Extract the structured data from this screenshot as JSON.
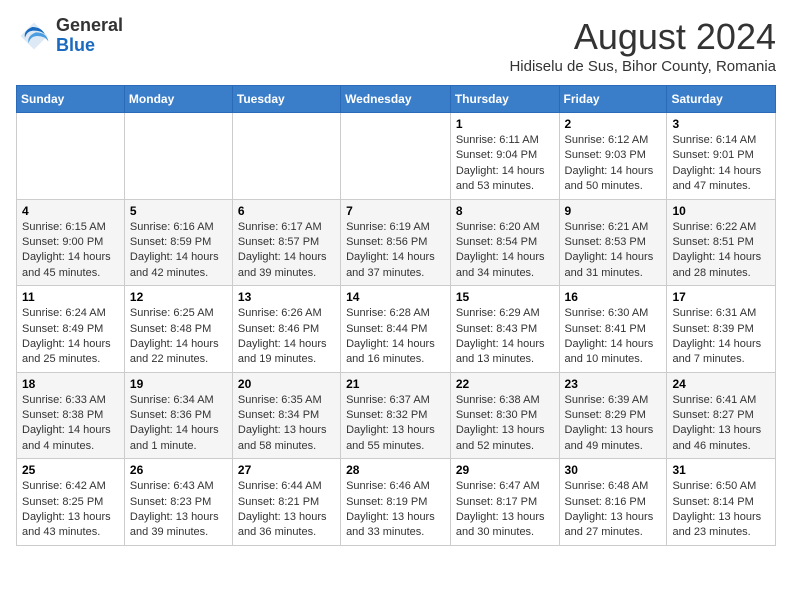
{
  "header": {
    "logo_general": "General",
    "logo_blue": "Blue",
    "month_year": "August 2024",
    "location": "Hidiselu de Sus, Bihor County, Romania"
  },
  "days_of_week": [
    "Sunday",
    "Monday",
    "Tuesday",
    "Wednesday",
    "Thursday",
    "Friday",
    "Saturday"
  ],
  "weeks": [
    [
      {
        "day": "",
        "info": ""
      },
      {
        "day": "",
        "info": ""
      },
      {
        "day": "",
        "info": ""
      },
      {
        "day": "",
        "info": ""
      },
      {
        "day": "1",
        "info": "Sunrise: 6:11 AM\nSunset: 9:04 PM\nDaylight: 14 hours and 53 minutes."
      },
      {
        "day": "2",
        "info": "Sunrise: 6:12 AM\nSunset: 9:03 PM\nDaylight: 14 hours and 50 minutes."
      },
      {
        "day": "3",
        "info": "Sunrise: 6:14 AM\nSunset: 9:01 PM\nDaylight: 14 hours and 47 minutes."
      }
    ],
    [
      {
        "day": "4",
        "info": "Sunrise: 6:15 AM\nSunset: 9:00 PM\nDaylight: 14 hours and 45 minutes."
      },
      {
        "day": "5",
        "info": "Sunrise: 6:16 AM\nSunset: 8:59 PM\nDaylight: 14 hours and 42 minutes."
      },
      {
        "day": "6",
        "info": "Sunrise: 6:17 AM\nSunset: 8:57 PM\nDaylight: 14 hours and 39 minutes."
      },
      {
        "day": "7",
        "info": "Sunrise: 6:19 AM\nSunset: 8:56 PM\nDaylight: 14 hours and 37 minutes."
      },
      {
        "day": "8",
        "info": "Sunrise: 6:20 AM\nSunset: 8:54 PM\nDaylight: 14 hours and 34 minutes."
      },
      {
        "day": "9",
        "info": "Sunrise: 6:21 AM\nSunset: 8:53 PM\nDaylight: 14 hours and 31 minutes."
      },
      {
        "day": "10",
        "info": "Sunrise: 6:22 AM\nSunset: 8:51 PM\nDaylight: 14 hours and 28 minutes."
      }
    ],
    [
      {
        "day": "11",
        "info": "Sunrise: 6:24 AM\nSunset: 8:49 PM\nDaylight: 14 hours and 25 minutes."
      },
      {
        "day": "12",
        "info": "Sunrise: 6:25 AM\nSunset: 8:48 PM\nDaylight: 14 hours and 22 minutes."
      },
      {
        "day": "13",
        "info": "Sunrise: 6:26 AM\nSunset: 8:46 PM\nDaylight: 14 hours and 19 minutes."
      },
      {
        "day": "14",
        "info": "Sunrise: 6:28 AM\nSunset: 8:44 PM\nDaylight: 14 hours and 16 minutes."
      },
      {
        "day": "15",
        "info": "Sunrise: 6:29 AM\nSunset: 8:43 PM\nDaylight: 14 hours and 13 minutes."
      },
      {
        "day": "16",
        "info": "Sunrise: 6:30 AM\nSunset: 8:41 PM\nDaylight: 14 hours and 10 minutes."
      },
      {
        "day": "17",
        "info": "Sunrise: 6:31 AM\nSunset: 8:39 PM\nDaylight: 14 hours and 7 minutes."
      }
    ],
    [
      {
        "day": "18",
        "info": "Sunrise: 6:33 AM\nSunset: 8:38 PM\nDaylight: 14 hours and 4 minutes."
      },
      {
        "day": "19",
        "info": "Sunrise: 6:34 AM\nSunset: 8:36 PM\nDaylight: 14 hours and 1 minute."
      },
      {
        "day": "20",
        "info": "Sunrise: 6:35 AM\nSunset: 8:34 PM\nDaylight: 13 hours and 58 minutes."
      },
      {
        "day": "21",
        "info": "Sunrise: 6:37 AM\nSunset: 8:32 PM\nDaylight: 13 hours and 55 minutes."
      },
      {
        "day": "22",
        "info": "Sunrise: 6:38 AM\nSunset: 8:30 PM\nDaylight: 13 hours and 52 minutes."
      },
      {
        "day": "23",
        "info": "Sunrise: 6:39 AM\nSunset: 8:29 PM\nDaylight: 13 hours and 49 minutes."
      },
      {
        "day": "24",
        "info": "Sunrise: 6:41 AM\nSunset: 8:27 PM\nDaylight: 13 hours and 46 minutes."
      }
    ],
    [
      {
        "day": "25",
        "info": "Sunrise: 6:42 AM\nSunset: 8:25 PM\nDaylight: 13 hours and 43 minutes."
      },
      {
        "day": "26",
        "info": "Sunrise: 6:43 AM\nSunset: 8:23 PM\nDaylight: 13 hours and 39 minutes."
      },
      {
        "day": "27",
        "info": "Sunrise: 6:44 AM\nSunset: 8:21 PM\nDaylight: 13 hours and 36 minutes."
      },
      {
        "day": "28",
        "info": "Sunrise: 6:46 AM\nSunset: 8:19 PM\nDaylight: 13 hours and 33 minutes."
      },
      {
        "day": "29",
        "info": "Sunrise: 6:47 AM\nSunset: 8:17 PM\nDaylight: 13 hours and 30 minutes."
      },
      {
        "day": "30",
        "info": "Sunrise: 6:48 AM\nSunset: 8:16 PM\nDaylight: 13 hours and 27 minutes."
      },
      {
        "day": "31",
        "info": "Sunrise: 6:50 AM\nSunset: 8:14 PM\nDaylight: 13 hours and 23 minutes."
      }
    ]
  ]
}
